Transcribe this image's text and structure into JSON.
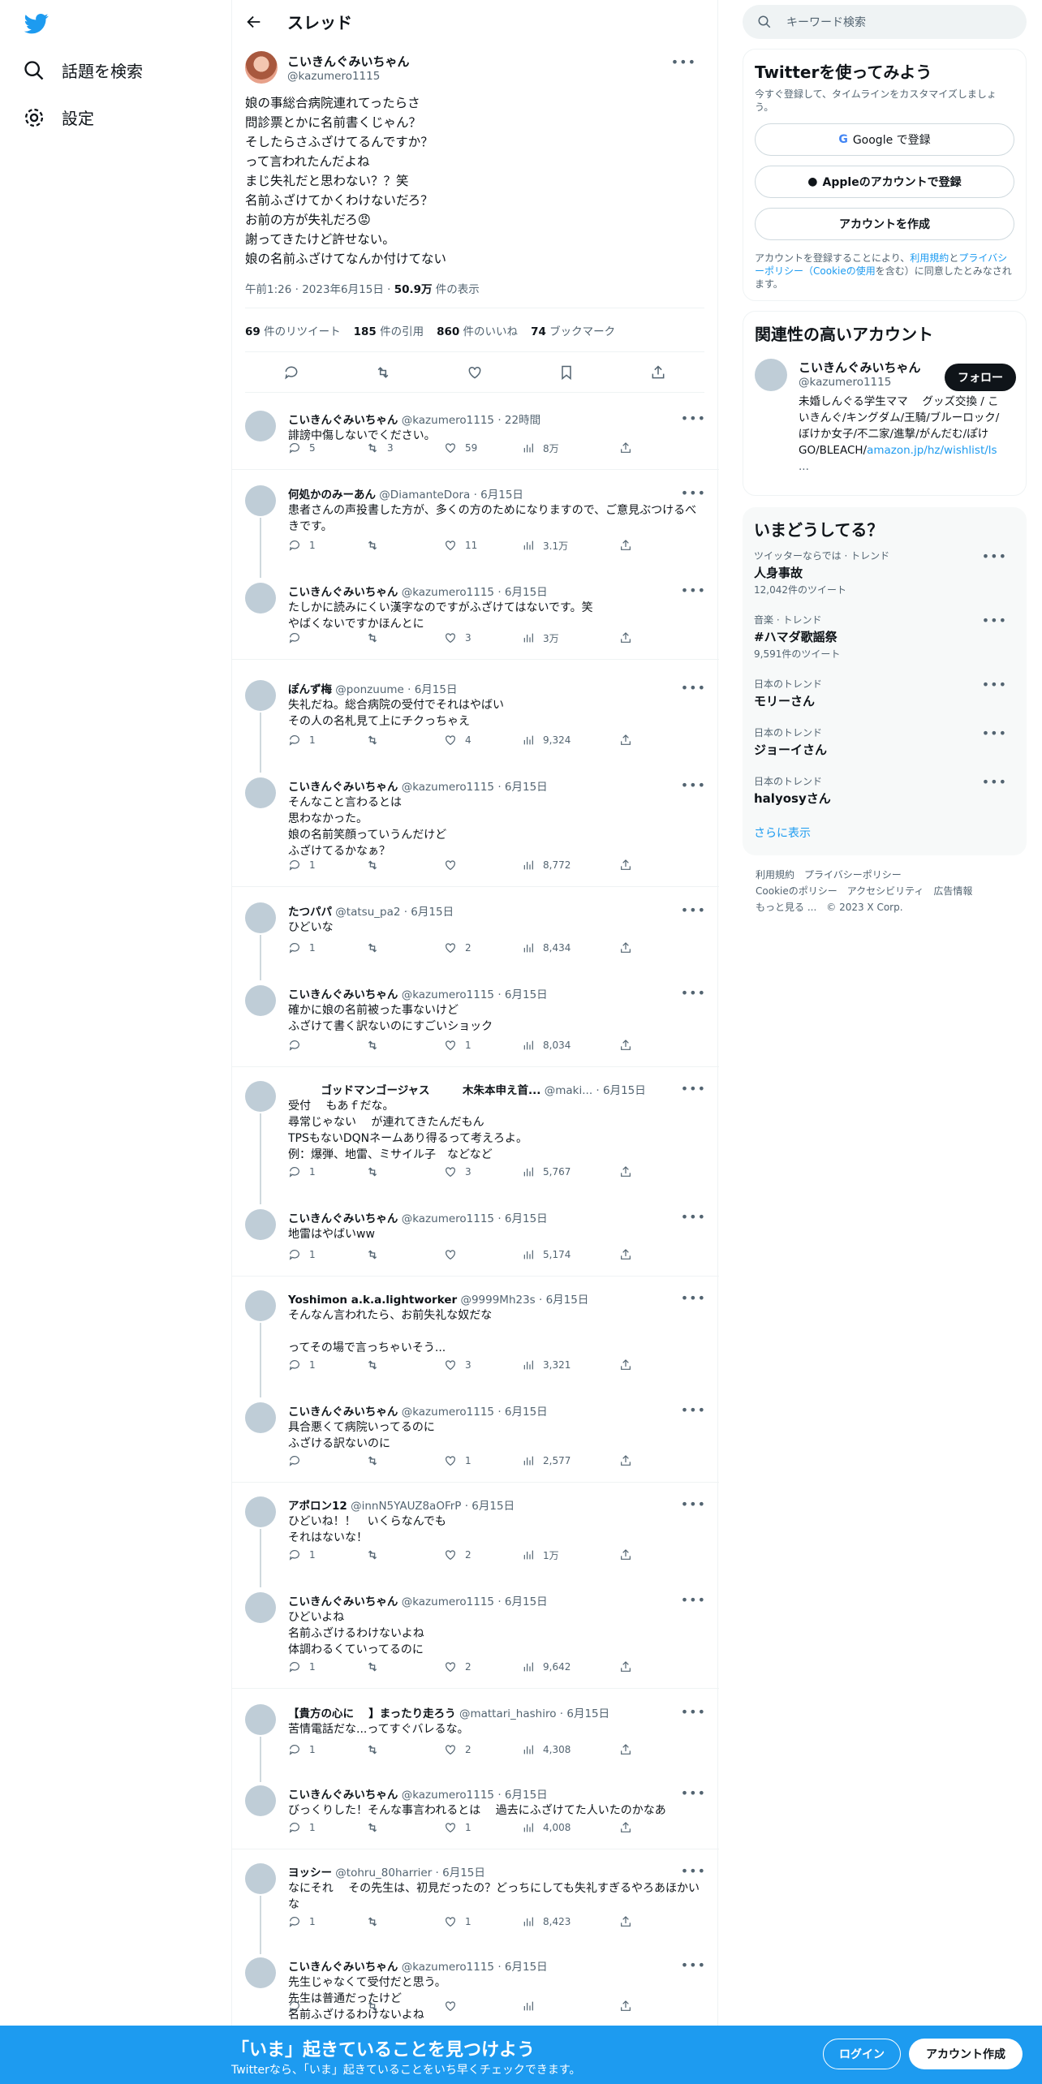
{
  "sidebar": {
    "items": [
      {
        "label": "話題を検索",
        "icon": "hash-search-icon"
      },
      {
        "label": "設定",
        "icon": "gear-icon"
      }
    ]
  },
  "header": {
    "title": "スレッド"
  },
  "root": {
    "name": "こいきんぐみいちゃん",
    "handle": "@kazumero1115",
    "text": "娘の事総合病院連れてったらさ\n問診票とかに名前書くじゃん？\nそしたらさふざけてるんですか？\nって言われたんだよね\nまじ失礼だと思わない？？笑\n名前ふざけてかくわけないだろ？\nお前の方が失礼だろ😡\n謝ってきたけど許せない。\n娘の名前ふざけてなんか付けてない",
    "time": "午前1:26 · 2023年6月15日 · ",
    "views": "50.9万",
    "views_label": " 件の表示",
    "stats": [
      {
        "num": "69",
        "label": " 件のリツイート"
      },
      {
        "num": "185",
        "label": " 件の引用"
      },
      {
        "num": "860",
        "label": " 件のいいね"
      },
      {
        "num": "74",
        "label": " ブックマーク"
      }
    ]
  },
  "replies": [
    {
      "name": "こいきんぐみいちゃん",
      "handle": "@kazumero1115 · 22時間",
      "text": "誹謗中傷しないでください。",
      "reply": "5",
      "rt": "3",
      "like": "59",
      "view": "8万"
    },
    {
      "name": "何処かのみーあん",
      "handle": "@DiamanteDora · 6月15日",
      "text": "患者さんの声投書した方が、多くの方のためになりますので、ご意見ぶつけるべきです。",
      "reply": "1",
      "rt": "",
      "like": "11",
      "view": "3.1万"
    },
    {
      "name": "こいきんぐみいちゃん",
      "handle": "@kazumero1115 · 6月15日",
      "text": "たしかに読みにくい漢字なのですがふざけてはないです。笑\nやばくないですかほんとに",
      "reply": "",
      "rt": "",
      "like": "3",
      "view": "3万"
    },
    {
      "name": "ぽんず梅",
      "handle": "@ponzuume · 6月15日",
      "text": "失礼だね。総合病院の受付でそれはやばい\nその人の名札見て上にチクっちゃえ",
      "reply": "1",
      "rt": "",
      "like": "4",
      "view": "9,324"
    },
    {
      "name": "こいきんぐみいちゃん",
      "handle": "@kazumero1115 · 6月15日",
      "text": "そんなこと言わるとは\n思わなかった。\n娘の名前笑顔っていうんだけど\nふざけてるかなぁ？",
      "reply": "1",
      "rt": "",
      "like": "",
      "view": "8,772"
    },
    {
      "name": "たつパパ",
      "handle": "@tatsu_pa2 · 6月15日",
      "text": "ひどいな",
      "reply": "1",
      "rt": "",
      "like": "2",
      "view": "8,434"
    },
    {
      "name": "こいきんぐみいちゃん",
      "handle": "@kazumero1115 · 6月15日",
      "text": "確かに娘の名前被った事ないけど\nふざけて書く訳ないのにすごいショック",
      "reply": "",
      "rt": "",
      "like": "1",
      "view": "8,034"
    },
    {
      "name": "　　　ゴッドマンゴージャス　　　木朱本申え首...",
      "handle": "@maki... · 6月15日",
      "text": "受付　 もあｆだな。\n尋常じゃない　 が連れてきたんだもん\nTPSもないDQNネームあり得るって考えろよ。\n例：爆弾、地雷、ミサイル子　などなど",
      "reply": "1",
      "rt": "",
      "like": "3",
      "view": "5,767"
    },
    {
      "name": "こいきんぐみいちゃん",
      "handle": "@kazumero1115 · 6月15日",
      "text": "地雷はやばいww",
      "reply": "1",
      "rt": "",
      "like": "",
      "view": "5,174"
    },
    {
      "name": "Yoshimon a.k.a.lightworker",
      "handle": "@9999Mh23s · 6月15日",
      "text": "そんなん言われたら、お前失礼な奴だな\n\nってその場で言っちゃいそう...",
      "reply": "1",
      "rt": "",
      "like": "3",
      "view": "3,321"
    },
    {
      "name": "こいきんぐみいちゃん",
      "handle": "@kazumero1115 · 6月15日",
      "text": "具合悪くて病院いってるのに\nふざける訳ないのに",
      "reply": "",
      "rt": "",
      "like": "1",
      "view": "2,577"
    },
    {
      "name": "アポロン12",
      "handle": "@innN5YAUZ8aOFrP · 6月15日",
      "text": "ひどいね！！　いくらなんでも\nそれはないな！",
      "reply": "1",
      "rt": "",
      "like": "2",
      "view": "1万"
    },
    {
      "name": "こいきんぐみいちゃん",
      "handle": "@kazumero1115 · 6月15日",
      "text": "ひどいよね\n名前ふざけるわけないよね\n体調わるくていってるのに",
      "reply": "1",
      "rt": "",
      "like": "2",
      "view": "9,642"
    },
    {
      "name": "【貴方の心に　 】まったり走ろう",
      "handle": "@mattari_hashiro · 6月15日",
      "text": "苦情電話だな...ってすぐバレるな。",
      "reply": "1",
      "rt": "",
      "like": "2",
      "view": "4,308"
    },
    {
      "name": "こいきんぐみいちゃん",
      "handle": "@kazumero1115 · 6月15日",
      "text": "びっくりした！そんな事言われるとは　 過去にふざけてた人いたのかなあ",
      "reply": "1",
      "rt": "",
      "like": "1",
      "view": "4,008"
    },
    {
      "name": "ヨッシー",
      "handle": "@tohru_80harrier · 6月15日",
      "text": "なにそれ　 その先生は、初見だったの？どっちにしても失礼すぎるやろあほかいな",
      "reply": "1",
      "rt": "",
      "like": "1",
      "view": "8,423"
    },
    {
      "name": "こいきんぐみいちゃん",
      "handle": "@kazumero1115 · 6月15日",
      "text": "先生じゃなくて受付だと思う。\n先生は普通だったけど\n名前ふざけるわけないよね",
      "reply": "",
      "rt": "",
      "like": "",
      "view": ""
    }
  ],
  "right": {
    "search_placeholder": "キーワード検索",
    "signup": {
      "title": "Twitterを使ってみよう",
      "sub": "今すぐ登録して、タイムラインをカスタマイズしましょう。",
      "google": "Google で登録",
      "apple": "Appleのアカウントで登録",
      "create": "アカウントを作成",
      "legal_pre": "アカウントを登録することにより、",
      "legal_link1": "利用規約",
      "legal_mid": "と",
      "legal_link2": "プライバシーポリシー（Cookieの使用",
      "legal_post": "を含む）に同意したとみなされます。"
    },
    "related": {
      "title": "関連性の高いアカウント",
      "name": "こいきんぐみいちゃん",
      "handle": "@kazumero1115",
      "follow": "フォロー",
      "bio": "未婚しんぐる学生ママ　 グッズ交換 / こいきんぐ/キングダム/王騎/ブルーロック/ぼけか女子/不二家/進撃/がんだむ/ぽけ\nGO/BLEACH/",
      "bio_link": "amazon.jp/hz/wishlist/ls",
      "bio_more": "..."
    },
    "trends": {
      "title": "いまどうしてる？",
      "items": [
        {
          "cat": "ツイッターならでは · トレンド",
          "name": "人身事故",
          "count": "12,042件のツイート"
        },
        {
          "cat": "音楽 · トレンド",
          "name": "#ハマダ歌謡祭",
          "count": "9,591件のツイート"
        },
        {
          "cat": "日本のトレンド",
          "name": "モリーさん",
          "count": ""
        },
        {
          "cat": "日本のトレンド",
          "name": "ジョーイさん",
          "count": ""
        },
        {
          "cat": "日本のトレンド",
          "name": "halyosyさん",
          "count": ""
        }
      ],
      "more": "さらに表示"
    },
    "footer": {
      "line1": "利用規約　プライバシーポリシー",
      "line2": "Cookieのポリシー　アクセシビリティ　広告情報",
      "line3": "もっと見る ...　© 2023 X Corp."
    }
  },
  "bottom": {
    "big": "「いま」起きていることを見つけよう",
    "small": "Twitterなら、「いま」起きていることをいち早くチェックできます。",
    "login": "ログイン",
    "signup": "アカウント作成"
  },
  "colors": {
    "accent": "#1d9bf0",
    "text": "#0f1419",
    "muted": "#536471"
  }
}
